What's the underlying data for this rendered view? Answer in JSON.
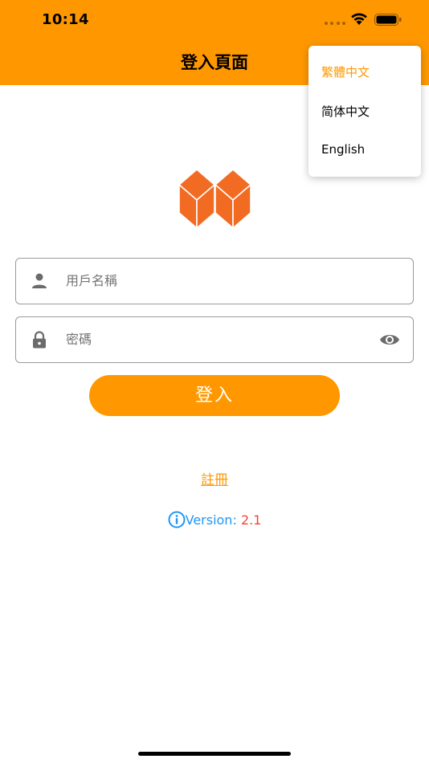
{
  "status_bar": {
    "time": "10:14"
  },
  "header": {
    "title": "登入頁面"
  },
  "language_menu": {
    "items": [
      {
        "label": "繁體中文",
        "selected": true
      },
      {
        "label": "简体中文",
        "selected": false
      },
      {
        "label": "English",
        "selected": false
      }
    ]
  },
  "form": {
    "username_placeholder": "用戶名稱",
    "password_placeholder": "密碼",
    "login_label": "登入"
  },
  "register": {
    "label": "註冊"
  },
  "version": {
    "label": "Version:",
    "number": "2.1"
  },
  "colors": {
    "accent": "#FF9800",
    "logo": "#F26B22",
    "info": "#2196F3",
    "version_number": "#F44336"
  }
}
